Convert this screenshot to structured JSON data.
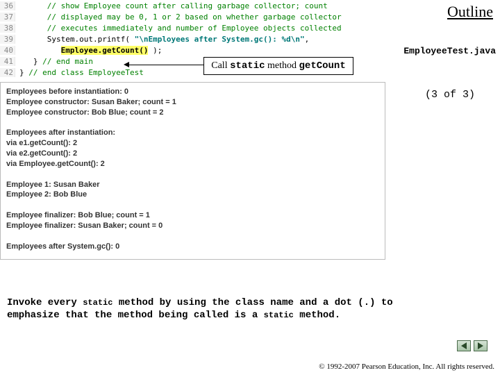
{
  "outline": "Outline",
  "filename": "EmployeeTest.java",
  "page_indicator": "(3 of  3)",
  "code": {
    "lines": [
      {
        "n": "36",
        "indent": "      ",
        "type": "comment",
        "text": "// show Employee count after calling garbage collector; count"
      },
      {
        "n": "37",
        "indent": "      ",
        "type": "comment",
        "text": "// displayed may be 0, 1 or 2 based on whether garbage collector"
      },
      {
        "n": "38",
        "indent": "      ",
        "type": "comment",
        "text": "// executes immediately and number of Employee objects collected"
      },
      {
        "n": "39",
        "indent": "      ",
        "type": "printf",
        "prefix": "System.out.printf( ",
        "str": "\"\\nEmployees after System.gc(): %d\\n\"",
        "suffix": ","
      },
      {
        "n": "40",
        "indent": "         ",
        "type": "hl",
        "hl": "Employee.getCount()",
        "tail": " );"
      },
      {
        "n": "41",
        "indent": "   ",
        "type": "endmain",
        "brace": "} ",
        "cmt": "// end main"
      },
      {
        "n": "42",
        "indent": "",
        "type": "endclass",
        "brace": "} ",
        "cmt": "// end class EmployeeTest"
      }
    ]
  },
  "callout": {
    "pre": "Call ",
    "kw1": "static",
    "mid": " method ",
    "kw2": "getCount"
  },
  "output": "Employees before instantiation: 0\nEmployee constructor: Susan Baker; count = 1\nEmployee constructor: Bob Blue; count = 2\n\nEmployees after instantiation:\nvia e1.getCount(): 2\nvia e2.getCount(): 2\nvia Employee.getCount(): 2\n\nEmployee 1: Susan Baker\nEmployee 2: Bob Blue\n\nEmployee finalizer: Bob Blue; count = 1\nEmployee finalizer: Susan Baker; count = 0\n\nEmployees after System.gc(): 0",
  "note": {
    "l1a": "Invoke every ",
    "l1b": "static",
    "l1c": " method by using the class name and a dot (.) to",
    "l2a": "emphasize that the method being called is a ",
    "l2b": "static",
    "l2c": " method."
  },
  "copyright": "© 1992-2007 Pearson Education, Inc.  All rights reserved."
}
